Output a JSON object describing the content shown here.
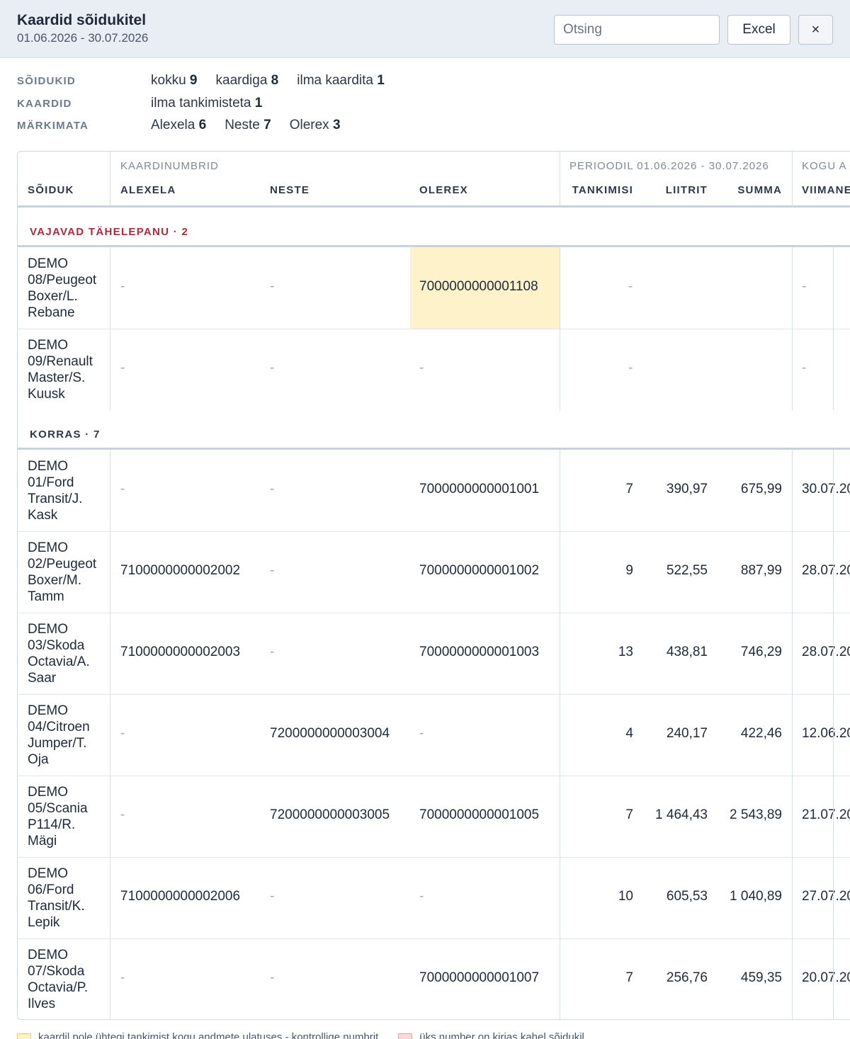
{
  "header": {
    "title": "Kaardid sõidukitel",
    "period": "01.06.2026 - 30.07.2026",
    "search_placeholder": "Otsing",
    "excel_label": "Excel",
    "close_label": "×"
  },
  "summary": [
    {
      "label": "SÕIDUKID",
      "items": [
        {
          "text": "kokku",
          "value": "9"
        },
        {
          "text": "kaardiga",
          "value": "8"
        },
        {
          "text": "ilma kaardita",
          "value": "1"
        }
      ]
    },
    {
      "label": "KAARDID",
      "items": [
        {
          "text": "ilma tankimisteta",
          "value": "1"
        }
      ]
    },
    {
      "label": "MÄRKIMATA",
      "items": [
        {
          "text": "Alexela",
          "value": "6"
        },
        {
          "text": "Neste",
          "value": "7"
        },
        {
          "text": "Olerex",
          "value": "3"
        }
      ]
    }
  ],
  "table": {
    "group_headers": {
      "cards": "KAARDINUMBRID",
      "period": "PERIOODIL 01.06.2026 - 30.07.2026",
      "total": "KOGU A"
    },
    "columns": {
      "vehicle": "SÕIDUK",
      "alexela": "ALEXELA",
      "neste": "NESTE",
      "olerex": "OLEREX",
      "refuels": "TANKIMISI",
      "liters": "LIITRIT",
      "sum": "SUMMA",
      "last": "VIIMANE"
    },
    "sections": [
      {
        "title": "VAJAVAD TÄHELEPANU · 2",
        "kind": "warn",
        "rows": [
          {
            "vehicle": "DEMO 08/Peugeot Boxer/L. Rebane",
            "alexela": "-",
            "neste": "-",
            "olerex": "7000000000001108",
            "olerex_highlight": "yellow",
            "refuels": "-",
            "liters": "",
            "sum": "",
            "last": "-"
          },
          {
            "vehicle": "DEMO 09/Renault Master/S. Kuusk",
            "alexela": "-",
            "neste": "-",
            "olerex": "-",
            "refuels": "-",
            "liters": "",
            "sum": "",
            "last": "-"
          }
        ]
      },
      {
        "title": "KORRAS · 7",
        "kind": "ok",
        "rows": [
          {
            "vehicle": "DEMO 01/Ford Transit/J. Kask",
            "alexela": "-",
            "neste": "-",
            "olerex": "7000000000001001",
            "refuels": "7",
            "liters": "390,97",
            "sum": "675,99",
            "last": "30.07.20"
          },
          {
            "vehicle": "DEMO 02/Peugeot Boxer/M. Tamm",
            "alexela": "7100000000002002",
            "neste": "-",
            "olerex": "7000000000001002",
            "refuels": "9",
            "liters": "522,55",
            "sum": "887,99",
            "last": "28.07.20"
          },
          {
            "vehicle": "DEMO 03/Skoda Octavia/A. Saar",
            "alexela": "7100000000002003",
            "neste": "-",
            "olerex": "7000000000001003",
            "refuels": "13",
            "liters": "438,81",
            "sum": "746,29",
            "last": "28.07.20"
          },
          {
            "vehicle": "DEMO 04/Citroen Jumper/T. Oja",
            "alexela": "-",
            "neste": "7200000000003004",
            "olerex": "-",
            "refuels": "4",
            "liters": "240,17",
            "sum": "422,46",
            "last": "12.06.20"
          },
          {
            "vehicle": "DEMO 05/Scania P114/R. Mägi",
            "alexela": "-",
            "neste": "7200000000003005",
            "olerex": "7000000000001005",
            "refuels": "7",
            "liters": "1 464,43",
            "sum": "2 543,89",
            "last": "21.07.20"
          },
          {
            "vehicle": "DEMO 06/Ford Transit/K. Lepik",
            "alexela": "7100000000002006",
            "neste": "-",
            "olerex": "-",
            "refuels": "10",
            "liters": "605,53",
            "sum": "1 040,89",
            "last": "27.07.20"
          },
          {
            "vehicle": "DEMO 07/Skoda Octavia/P. Ilves",
            "alexela": "-",
            "neste": "-",
            "olerex": "7000000000001007",
            "refuels": "7",
            "liters": "256,76",
            "sum": "459,35",
            "last": "20.07.20"
          }
        ]
      }
    ]
  },
  "legend": [
    {
      "color": "#fdf2c9",
      "text": "kaardil pole ühtegi tankimist kogu andmete ulatuses - kontrollige numbrit"
    },
    {
      "color": "#f9d9dc",
      "text": "üks number on kirjas kahel sõidukil"
    }
  ]
}
